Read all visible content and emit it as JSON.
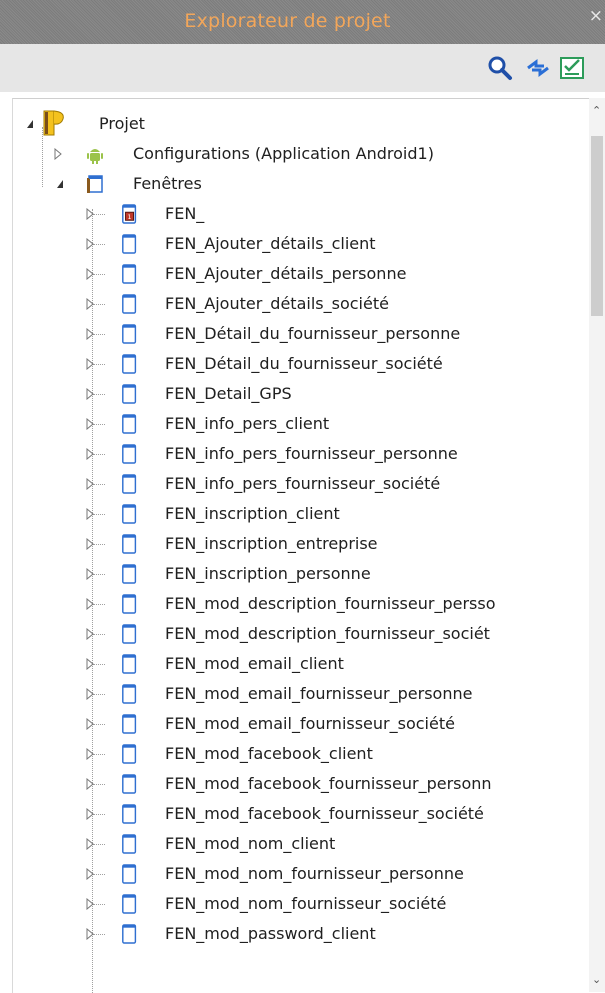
{
  "panel": {
    "title": "Explorateur de projet",
    "close_glyph": "×"
  },
  "toolbar": {
    "icons": [
      "search-icon",
      "sync-icon",
      "checklist-icon"
    ]
  },
  "tree": {
    "root": {
      "label": "Projet",
      "icon": "project-icon"
    },
    "config": {
      "label": "Configurations (Application Android1)",
      "icon": "android-icon"
    },
    "windows": {
      "label": "Fenêtres",
      "icon": "folder-icon"
    },
    "items": [
      "FEN_",
      "FEN_Ajouter_détails_client",
      "FEN_Ajouter_détails_personne",
      "FEN_Ajouter_détails_société",
      "FEN_Détail_du_fournisseur_personne",
      "FEN_Détail_du_fournisseur_société",
      "FEN_Detail_GPS",
      "FEN_info_pers_client",
      "FEN_info_pers_fournisseur_personne",
      "FEN_info_pers_fournisseur_société",
      "FEN_inscription_client",
      "FEN_inscription_entreprise",
      "FEN_inscription_personne",
      "FEN_mod_description_fournisseur_persso",
      "FEN_mod_description_fournisseur_sociét",
      "FEN_mod_email_client",
      "FEN_mod_email_fournisseur_personne",
      "FEN_mod_email_fournisseur_société",
      "FEN_mod_facebook_client",
      "FEN_mod_facebook_fournisseur_personn",
      "FEN_mod_facebook_fournisseur_société",
      "FEN_mod_nom_client",
      "FEN_mod_nom_fournisseur_personne",
      "FEN_mod_nom_fournisseur_société",
      "FEN_mod_password_client"
    ]
  },
  "colors": {
    "title_text": "#f2a65a",
    "window_icon_border": "#2f6fd0",
    "android_green": "#9bc34a"
  }
}
